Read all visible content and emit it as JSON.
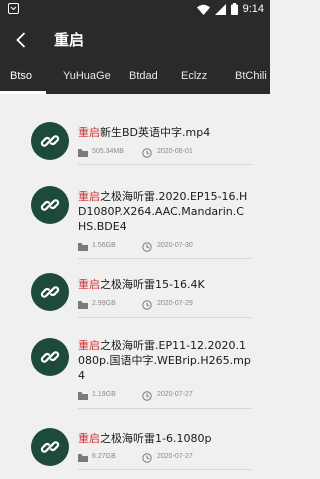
{
  "status_bar": {
    "time": "9:14"
  },
  "app_bar": {
    "title": "重启"
  },
  "tabs": [
    "Btso",
    "YuHuaGe",
    "Btdad",
    "Eclzz",
    "BtChili"
  ],
  "results": [
    {
      "highlight": "重启",
      "rest": "新生BD英语中字.mp4",
      "size": "505.34MB",
      "date": "2020-08-01"
    },
    {
      "highlight": "重启",
      "rest": "之极海听雷.2020.EP15-16.HD1080P.X264.AAC.Mandarin.CHS.BDE4",
      "size": "1.56GB",
      "date": "2020-07-30"
    },
    {
      "highlight": "重启",
      "rest": "之极海听雷15-16.4K",
      "size": "2.99GB",
      "date": "2020-07-29"
    },
    {
      "highlight": "重启",
      "rest": "之极海听雷.EP11-12.2020.1080p.国语中字.WEBrip.H265.mp4",
      "size": "1.19GB",
      "date": "2020-07-27"
    },
    {
      "highlight": "重启",
      "rest": "之极海听雷1-6.1080p",
      "size": "6.27GB",
      "date": "2020-07-27"
    }
  ],
  "colors": {
    "header": "#2a2a2a",
    "avatar": "#1d4a3b",
    "highlight": "#d32f2f",
    "background": "#f0f0f0"
  }
}
